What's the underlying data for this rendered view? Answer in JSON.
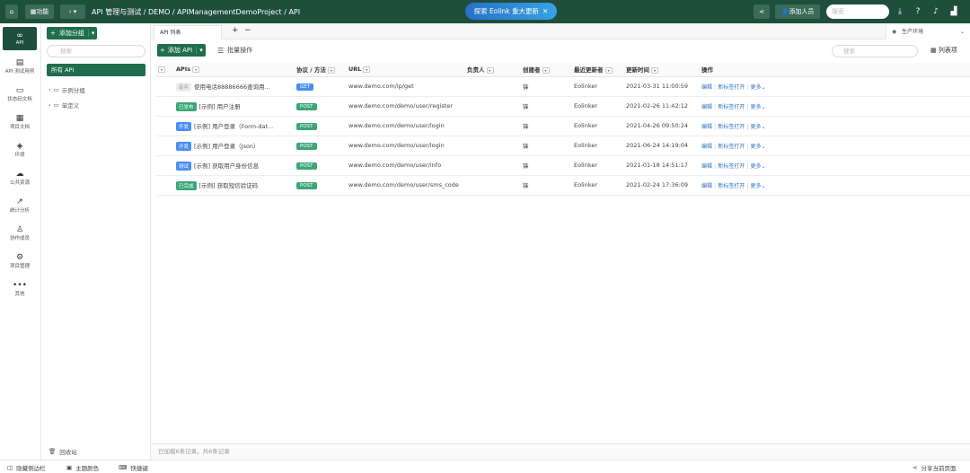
{
  "top": {
    "function_label": "功能",
    "breadcrumb": "API 管理与测试 / DEMO / APIManagementDemoProject / API",
    "banner": "探索 Eolink 重大更新",
    "add_member": "添加人员",
    "search_placeholder": "搜索"
  },
  "rail": {
    "items": [
      "API",
      "API 测试用例",
      "状态码文档",
      "项目文档",
      "环境",
      "公共资源",
      "统计分析",
      "协作成员",
      "项目管理",
      "其他"
    ]
  },
  "tree": {
    "add_group": "添加分组",
    "search_placeholder": "搜索",
    "all_api": "所有 API",
    "groups": [
      "示例分组",
      "单定义"
    ],
    "recycle": "回收站"
  },
  "main": {
    "tab": "API 列表",
    "env": "生产环境",
    "add_api": "添加 API",
    "batch": "批量操作",
    "search_placeholder": "搜索",
    "columns_btn": "列表项",
    "headers": {
      "apis": "APIs",
      "protocol": "协议 / 方法",
      "url": "URL",
      "owner": "负责人",
      "creator": "创建者",
      "updater": "最近更新者",
      "time": "更新时间",
      "ops": "操作"
    },
    "rows": [
      {
        "status": "废弃",
        "name": "使用电话88886666查询用...",
        "method": "GET",
        "url": "www.demo.com/ip/get",
        "creator": "锋",
        "updater": "Eolinker",
        "time": "2021-03-31 11:00:59"
      },
      {
        "status": "已发布",
        "name": "[示例] 用户注册",
        "method": "POST",
        "url": "www.demo.com/demo/user/register",
        "creator": "锋",
        "updater": "Eolinker",
        "time": "2021-02-26 11:42:12"
      },
      {
        "status": "开发",
        "name": "[示例] 用户登录（Form-dat...",
        "method": "POST",
        "url": "www.demo.com/demo/user/login",
        "creator": "锋",
        "updater": "Eolinker",
        "time": "2021-04-26 09:50:24"
      },
      {
        "status": "开发",
        "name": "[示例] 用户登录（Json）",
        "method": "POST",
        "url": "www.demo.com/demo/user/login",
        "creator": "锋",
        "updater": "Eolinker",
        "time": "2021-06-24 14:19:04"
      },
      {
        "status": "测试",
        "name": "[示例] 获取用户身份信息",
        "method": "POST",
        "url": "www.demo.com/demo/user/info",
        "creator": "锋",
        "updater": "Eolinker",
        "time": "2021-01-18 14:51:17"
      },
      {
        "status": "已完成",
        "name": "[示例] 获取短信验证码",
        "method": "POST",
        "url": "www.demo.com/demo/user/sms_code",
        "creator": "锋",
        "updater": "Eolinker",
        "time": "2021-02-24 17:36:09"
      }
    ],
    "ops": {
      "edit": "编辑",
      "newtab": "新标签打开",
      "more": "更多"
    },
    "footer": "已加载6条记录，共6条记录"
  },
  "bottom": {
    "hide_sidebar": "隐藏侧边栏",
    "theme": "主题颜色",
    "shortcuts": "快捷键",
    "share": "分享当前页面"
  },
  "colors": {
    "brand": "#1f4e3d",
    "primary": "#1f6e4c",
    "link": "#2f74c0"
  }
}
